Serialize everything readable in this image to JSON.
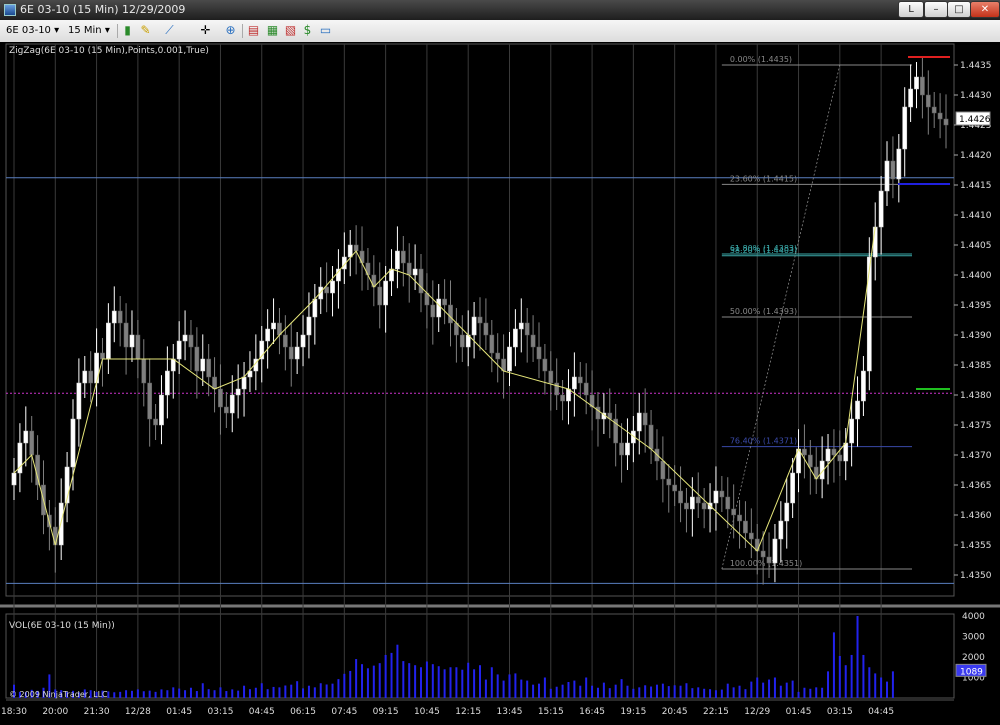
{
  "window": {
    "title": "6E 03-10 (15 Min)  12/29/2009",
    "btn_l": "L",
    "btn_min": "–",
    "btn_max": "□",
    "btn_close": "✕"
  },
  "toolbar": {
    "instrument": "6E 03-10 ▾",
    "interval": "15 Min ▾",
    "icons": [
      "candlestick-icon",
      "pencil-icon",
      "draw-tools-icon",
      "crosshair-icon",
      "zoom-icon",
      "strategy-icon",
      "data-box-icon",
      "chart-trader-icon",
      "dollar-icon",
      "properties-icon"
    ]
  },
  "colors": {
    "up": "#ffffff",
    "down": "#7f7f7f",
    "zigzag": "#e6e67a",
    "grid": "#3a3a3a",
    "h_line_blue": "#5a7fc0",
    "h_line_magenta": "#cc33cc",
    "volume": "#2222ee",
    "fib_gray": "#888888",
    "fib_teal": "#3aa9a9"
  },
  "chart_data": {
    "type": "candlestick",
    "indicator_label": "ZigZag(6E 03-10 (15 Min),Points,0.001,True)",
    "ylim": [
      1.43465,
      1.44385
    ],
    "y_ticks": [
      "1.4435",
      "1.4430",
      "1.4425",
      "1.4420",
      "1.4415",
      "1.4410",
      "1.4405",
      "1.4400",
      "1.4395",
      "1.4390",
      "1.4385",
      "1.4380",
      "1.4375",
      "1.4370",
      "1.4365",
      "1.4360",
      "1.4355",
      "1.4350"
    ],
    "last_price": "1.4426",
    "x_labels": [
      "18:30",
      "20:00",
      "21:30",
      "12/28",
      "01:45",
      "03:15",
      "04:45",
      "06:15",
      "07:45",
      "09:15",
      "10:45",
      "12:15",
      "13:45",
      "15:15",
      "16:45",
      "19:15",
      "20:45",
      "22:15",
      "12/29",
      "01:45",
      "03:15",
      "04:45"
    ],
    "closes": [
      1.4367,
      1.4372,
      1.4374,
      1.437,
      1.4365,
      1.436,
      1.4358,
      1.4355,
      1.4362,
      1.4368,
      1.4376,
      1.4382,
      1.4384,
      1.4382,
      1.4387,
      1.4386,
      1.4392,
      1.4394,
      1.4392,
      1.4388,
      1.439,
      1.4386,
      1.4382,
      1.4376,
      1.4375,
      1.438,
      1.4384,
      1.4386,
      1.4389,
      1.439,
      1.4388,
      1.4384,
      1.4386,
      1.4383,
      1.4381,
      1.4378,
      1.4377,
      1.438,
      1.4381,
      1.4383,
      1.4384,
      1.4386,
      1.4389,
      1.4391,
      1.4392,
      1.439,
      1.4388,
      1.4386,
      1.4388,
      1.439,
      1.4393,
      1.4396,
      1.4398,
      1.4397,
      1.4399,
      1.4401,
      1.4403,
      1.4405,
      1.4404,
      1.4402,
      1.44,
      1.4398,
      1.4395,
      1.4399,
      1.4401,
      1.4404,
      1.4402,
      1.44,
      1.4401,
      1.4397,
      1.4395,
      1.4393,
      1.4396,
      1.4395,
      1.4392,
      1.439,
      1.4388,
      1.439,
      1.4393,
      1.4392,
      1.439,
      1.4387,
      1.4386,
      1.4384,
      1.4388,
      1.4391,
      1.4392,
      1.439,
      1.4388,
      1.4386,
      1.4384,
      1.4382,
      1.438,
      1.4379,
      1.4381,
      1.4383,
      1.4382,
      1.438,
      1.4378,
      1.4376,
      1.4377,
      1.4376,
      1.4372,
      1.437,
      1.4372,
      1.4374,
      1.4377,
      1.4375,
      1.4371,
      1.4369,
      1.4366,
      1.4365,
      1.4364,
      1.4362,
      1.4361,
      1.4363,
      1.4362,
      1.4361,
      1.4362,
      1.4364,
      1.4363,
      1.4361,
      1.436,
      1.4359,
      1.4357,
      1.4356,
      1.4354,
      1.4353,
      1.4352,
      1.4356,
      1.4359,
      1.4362,
      1.4367,
      1.4371,
      1.437,
      1.4368,
      1.4366,
      1.4369,
      1.4371,
      1.437,
      1.4369,
      1.4372,
      1.4376,
      1.4379,
      1.4384,
      1.4403,
      1.4408,
      1.4414,
      1.4419,
      1.4416,
      1.4421,
      1.4428,
      1.4431,
      1.4433,
      1.443,
      1.4428,
      1.4427,
      1.4426,
      1.4425
    ],
    "x_label_bars": [
      0,
      7,
      14,
      21,
      28,
      35,
      42,
      49,
      56,
      63,
      70,
      77,
      84,
      91,
      98,
      105,
      112,
      119,
      126,
      133,
      140,
      147
    ],
    "zigzag_bars": [
      0,
      3,
      7,
      15,
      21,
      27,
      34,
      39,
      45,
      51,
      58,
      61,
      64,
      67,
      77,
      83,
      94,
      108,
      126,
      133,
      136,
      141,
      146
    ],
    "fib_levels": [
      {
        "label": "0.00% (1.4435)",
        "price": 1.4435,
        "color": "gray"
      },
      {
        "label": "23.60% (1.4415)",
        "price": 1.44151,
        "color": "gray"
      },
      {
        "label": "38.20% (1.4403)",
        "price": 1.44032,
        "color": "teal"
      },
      {
        "label": "50.00% (1.4393)",
        "price": 1.4393,
        "color": "gray"
      },
      {
        "label": "61.80% (1.4383)",
        "price": 1.44035,
        "color": "teal"
      },
      {
        "label": "76.40% (1.4371)",
        "price": 1.43714,
        "color": "blue"
      },
      {
        "label": "100.00% (1.4351)",
        "price": 1.4351,
        "color": "gray"
      }
    ],
    "h_lines": [
      1.44162,
      1.43803,
      1.43486
    ],
    "volume": {
      "label": "VOL(6E 03-10 (15 Min))",
      "y_ticks": [
        "4000",
        "3000",
        "2000",
        "1000"
      ],
      "ylim": [
        0,
        4000
      ],
      "last": "1089",
      "values": [
        650,
        300,
        280,
        400,
        350,
        500,
        1150,
        420,
        380,
        300,
        350,
        280,
        420,
        380,
        300,
        360,
        320,
        280,
        300,
        380,
        350,
        420,
        330,
        360,
        300,
        420,
        380,
        520,
        460,
        380,
        500,
        340,
        720,
        430,
        380,
        520,
        340,
        420,
        360,
        600,
        430,
        500,
        720,
        430,
        540,
        520,
        610,
        650,
        820,
        470,
        600,
        520,
        720,
        660,
        700,
        920,
        1180,
        1320,
        1900,
        1650,
        1450,
        1580,
        1700,
        2100,
        2200,
        2600,
        1800,
        1700,
        1600,
        1500,
        1780,
        1650,
        1550,
        1400,
        1500,
        1500,
        1380,
        1720,
        1400,
        1600,
        900,
        1500,
        1150,
        850,
        1150,
        1200,
        900,
        850,
        650,
        700,
        1000,
        450,
        550,
        650,
        780,
        850,
        600,
        1000,
        600,
        500,
        750,
        480,
        650,
        920,
        600,
        450,
        520,
        620,
        560,
        650,
        700,
        580,
        620,
        600,
        720,
        480,
        520,
        450,
        430,
        380,
        410,
        700,
        520,
        600,
        430,
        800,
        1000,
        750,
        900,
        1000,
        600,
        750,
        850,
        300,
        500,
        450,
        520,
        500,
        1300,
        3200,
        2050,
        1600,
        2100,
        4000,
        2100,
        1500,
        1200,
        1000,
        800,
        1300
      ]
    }
  },
  "copyright": "© 2009 NinjaTrader, LLC"
}
